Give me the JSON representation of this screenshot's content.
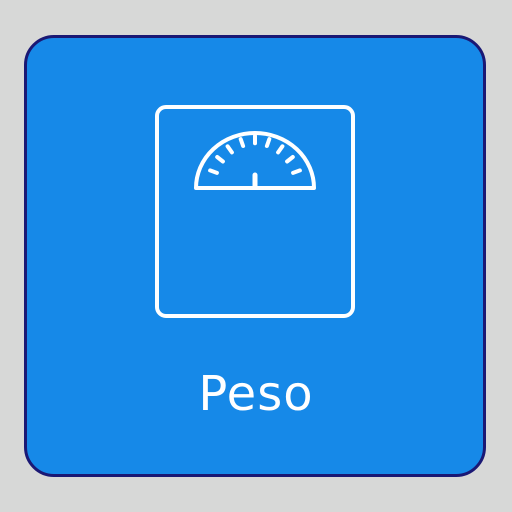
{
  "app": {
    "label": "Peso",
    "icon": "bathroom-scale-icon",
    "colors": {
      "background": "#d7d8d7",
      "tile": "#1689e8",
      "tile_border": "#1a1874",
      "foreground": "#ffffff"
    }
  }
}
